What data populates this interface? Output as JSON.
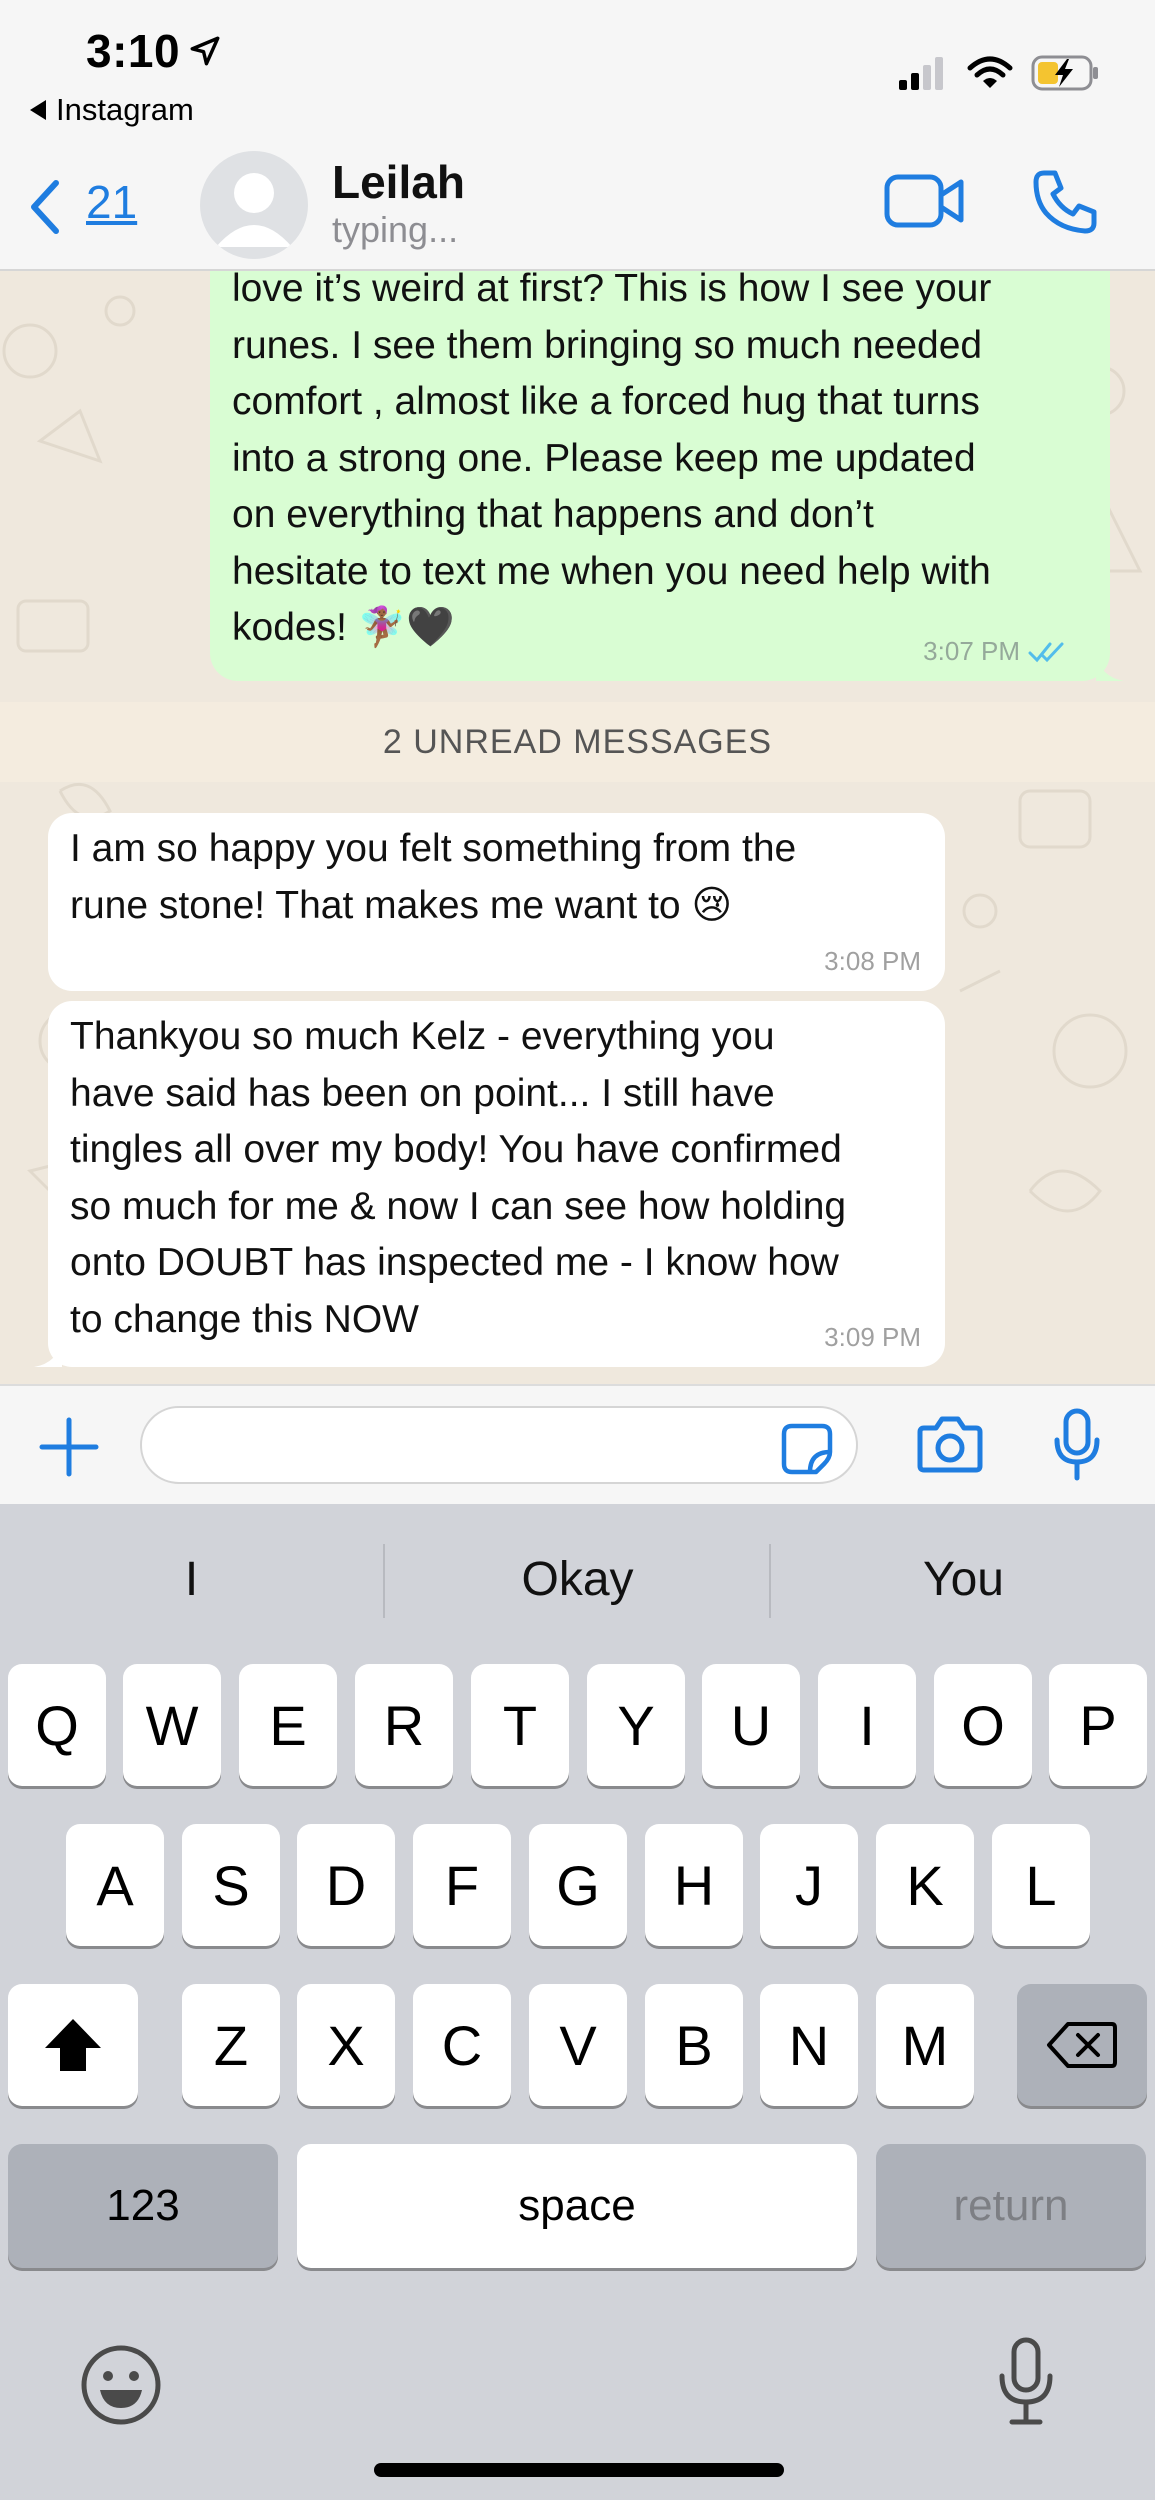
{
  "status_bar": {
    "time": "3:10",
    "back_app": "Instagram"
  },
  "header": {
    "back_count": "21",
    "contact_name": "Leilah",
    "contact_status": "typing..."
  },
  "messages": [
    {
      "direction": "outgoing",
      "lines": [
        "love it’s weird at first? This is how I see your",
        "runes. I see them bringing so much needed",
        "comfort , almost like a forced hug that turns",
        "into a strong one. Please keep me updated",
        "on everything that happens and don’t",
        "hesitate to text me when you need help with",
        "kodes! 🧚🏾‍♀️🖤"
      ],
      "time": "3:07 PM",
      "read": true
    },
    {
      "direction": "incoming",
      "lines": [
        "I am so happy you felt something from the",
        "rune stone! That makes me want to 😢"
      ],
      "time": "3:08 PM"
    },
    {
      "direction": "incoming",
      "lines": [
        "Thankyou so much Kelz - everything you",
        "have said has been on point... I still have",
        "tingles all over my body! You have confirmed",
        "so much for me & now I can see how holding",
        "onto DOUBT has inspected me - I know how",
        "to change this NOW"
      ],
      "time": "3:09 PM"
    }
  ],
  "unread_banner": "2 UNREAD MESSAGES",
  "input": {
    "value": ""
  },
  "keyboard": {
    "suggestions": [
      "I",
      "Okay",
      "You"
    ],
    "row1": [
      "Q",
      "W",
      "E",
      "R",
      "T",
      "Y",
      "U",
      "I",
      "O",
      "P"
    ],
    "row2": [
      "A",
      "S",
      "D",
      "F",
      "G",
      "H",
      "J",
      "K",
      "L"
    ],
    "row3": [
      "Z",
      "X",
      "C",
      "V",
      "B",
      "N",
      "M"
    ],
    "numbers_label": "123",
    "space_label": "space",
    "return_label": "return"
  },
  "colors": {
    "accent": "#1f7de0",
    "outgoing_bubble": "#d9fdd3",
    "incoming_bubble": "#ffffff",
    "chat_background": "#efe8dd",
    "read_ticks": "#53bdeb"
  },
  "icons": {
    "header": [
      "back-chevron-icon",
      "avatar-icon",
      "video-call-icon",
      "phone-icon"
    ],
    "input_bar": [
      "plus-icon",
      "sticker-icon",
      "camera-icon",
      "microphone-icon"
    ],
    "keyboard": [
      "shift-icon",
      "backspace-icon",
      "emoji-icon",
      "dictation-icon"
    ]
  }
}
